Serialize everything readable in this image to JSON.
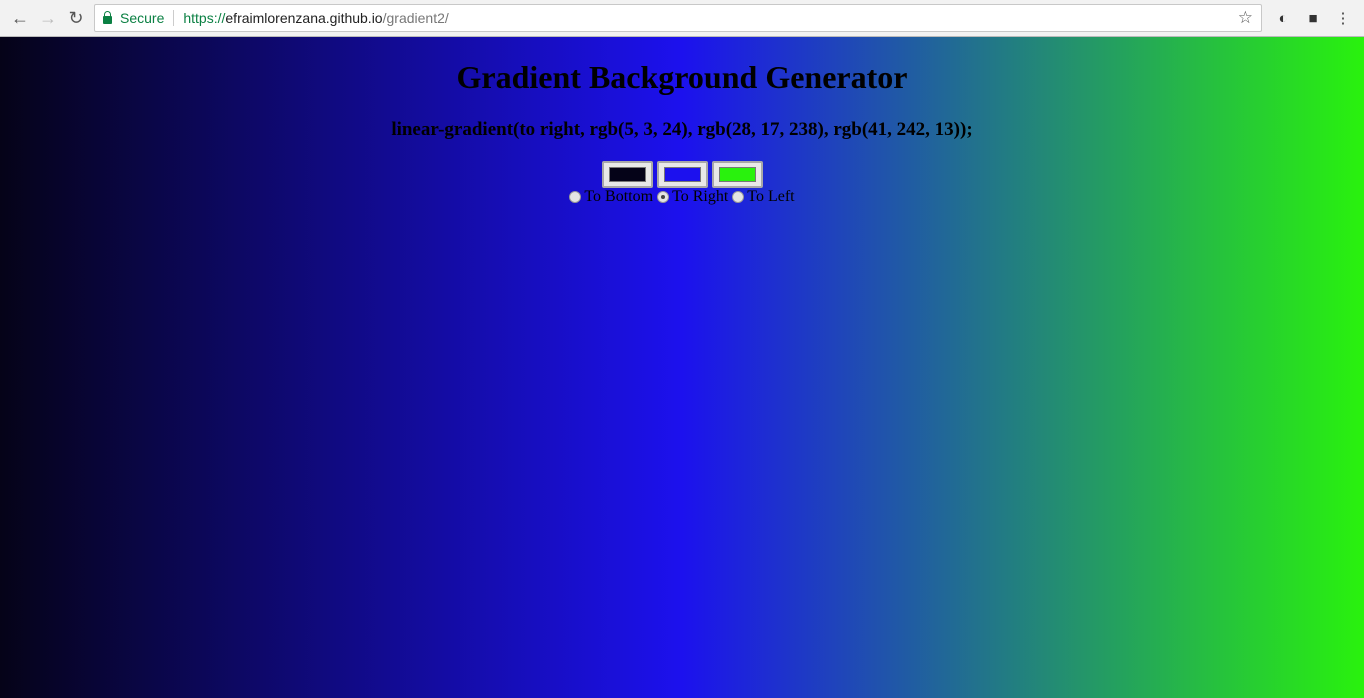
{
  "browser": {
    "secure_label": "Secure",
    "url_scheme": "https://",
    "url_host": "efraimlorenzana.github.io",
    "url_path": "/gradient2/"
  },
  "page": {
    "title": "Gradient Background Generator",
    "css_output": "linear-gradient(to right, rgb(5, 3, 24), rgb(28, 17, 238), rgb(41, 242, 13));",
    "colors": [
      "#050318",
      "#1c11ee",
      "#29f20d"
    ],
    "directions": [
      {
        "label": "To Bottom",
        "checked": false
      },
      {
        "label": "To Right",
        "checked": true
      },
      {
        "label": "To Left",
        "checked": false
      }
    ]
  }
}
